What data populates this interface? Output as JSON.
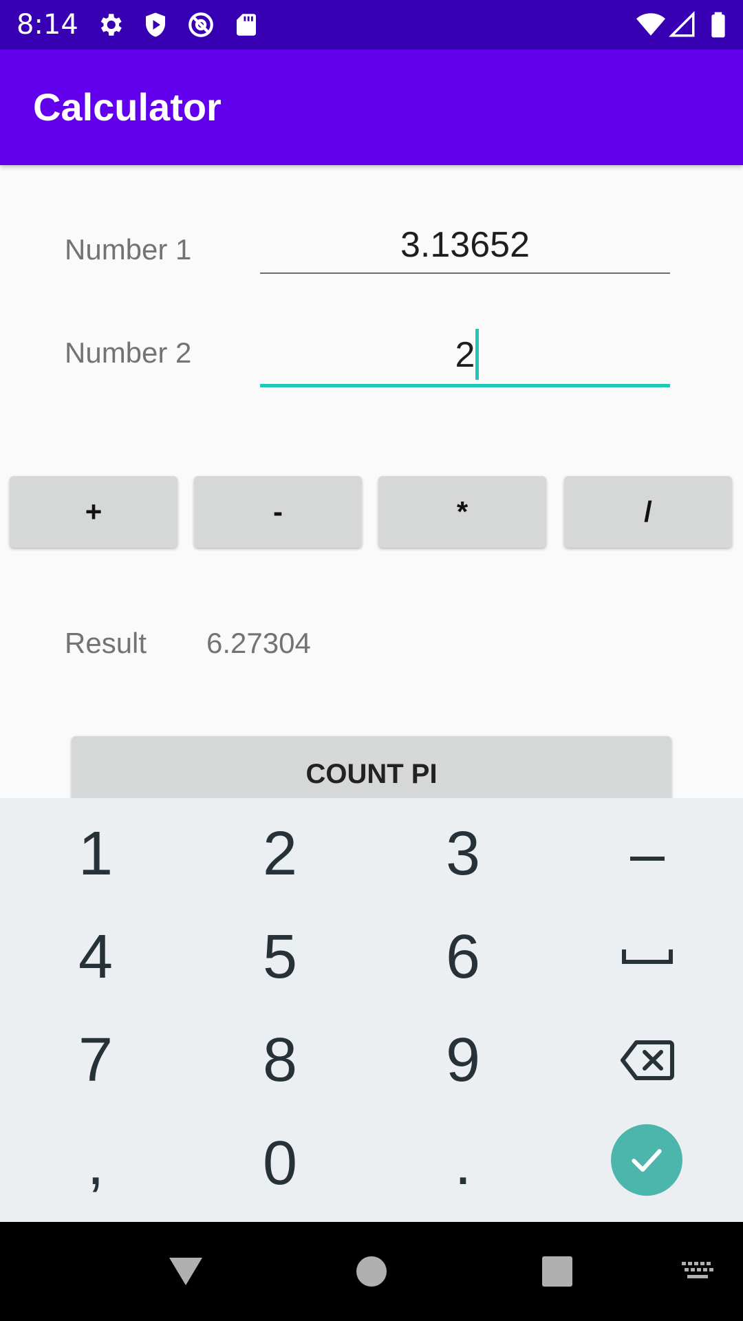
{
  "status_bar": {
    "time": "8:14",
    "left_icons": [
      "gear-icon",
      "play-shield-icon",
      "at-sign-icon",
      "sd-card-icon"
    ],
    "right_icons": [
      "wifi-icon",
      "signal-icon",
      "battery-icon"
    ]
  },
  "app_bar": {
    "title": "Calculator",
    "color": "#6200ee"
  },
  "form": {
    "number1": {
      "label": "Number 1",
      "value": "3.13652"
    },
    "number2": {
      "label": "Number 2",
      "value": "2"
    }
  },
  "operators": [
    "+",
    "-",
    "*",
    "/"
  ],
  "result": {
    "label": "Result",
    "value": "6.27304"
  },
  "count_pi_label": "COUNT PI",
  "keyboard": {
    "rows": [
      [
        "1",
        "2",
        "3",
        "–"
      ],
      [
        "4",
        "5",
        "6",
        "space"
      ],
      [
        "7",
        "8",
        "9",
        "backspace"
      ],
      [
        ",",
        "0",
        ".",
        "done"
      ]
    ],
    "accent_color": "#4db6ac"
  },
  "nav_bar": {
    "icons": [
      "back-icon",
      "home-icon",
      "recents-icon",
      "keyboard-switch-icon"
    ]
  }
}
